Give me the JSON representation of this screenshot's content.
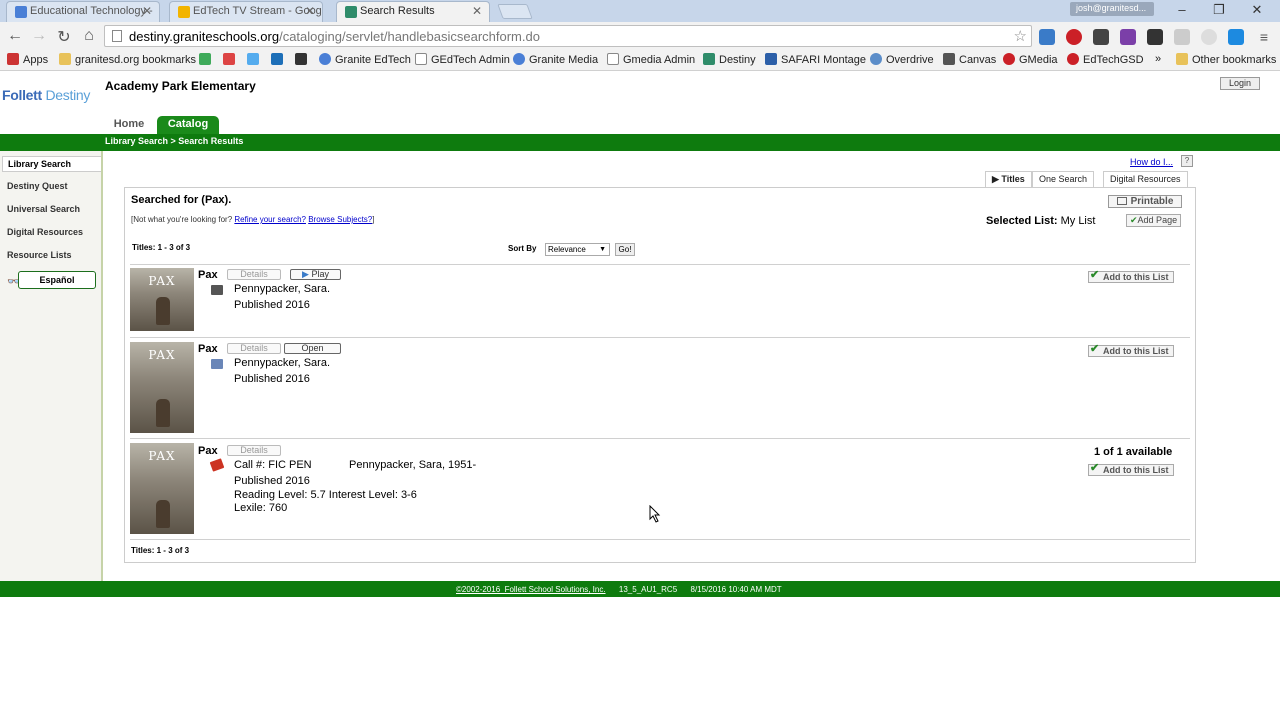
{
  "browser": {
    "tabs": [
      {
        "label": "Educational Technology -",
        "icon": "google-icon",
        "active": false
      },
      {
        "label": "EdTech TV Stream - Goog",
        "icon": "slides-icon",
        "active": false
      },
      {
        "label": "Search Results",
        "icon": "destiny-icon",
        "active": true
      }
    ],
    "profile": "josh@granitesd...",
    "url_host": "destiny.graniteschools.org",
    "url_path": "/cataloging/servlet/handlebasicsearchform.do",
    "bookmarks": [
      {
        "label": "Apps",
        "icon": "apps-grid-icon"
      },
      {
        "label": "granitesd.org bookmarks",
        "icon": "folder-icon"
      },
      {
        "label": "",
        "icon": "drive-icon"
      },
      {
        "label": "",
        "icon": "gmail-icon"
      },
      {
        "label": "",
        "icon": "twitter-icon"
      },
      {
        "label": "",
        "icon": "twitter-square-icon"
      },
      {
        "label": "",
        "icon": "layers-icon"
      },
      {
        "label": "Granite EdTech",
        "icon": "google-icon"
      },
      {
        "label": "GEdTech Admin",
        "icon": "page-icon"
      },
      {
        "label": "Granite Media",
        "icon": "google-icon"
      },
      {
        "label": "Gmedia Admin",
        "icon": "page-icon"
      },
      {
        "label": "Destiny",
        "icon": "destiny-icon"
      },
      {
        "label": "SAFARI Montage",
        "icon": "m-icon"
      },
      {
        "label": "Overdrive",
        "icon": "overdrive-icon"
      },
      {
        "label": "Canvas",
        "icon": "canvas-icon"
      },
      {
        "label": "GMedia",
        "icon": "pinterest-icon"
      },
      {
        "label": "EdTechGSD",
        "icon": "pinterest-icon"
      },
      {
        "label": "»",
        "icon": ""
      },
      {
        "label": "Other bookmarks",
        "icon": "folder-icon"
      }
    ]
  },
  "destiny": {
    "logo_main": "Follett",
    "logo_sub": "Destiny",
    "school": "Academy Park Elementary",
    "login": "Login",
    "nav": {
      "home": "Home",
      "catalog": "Catalog"
    },
    "breadcrumb": "Library Search > Search Results",
    "sidebar": [
      "Library Search",
      "Destiny Quest",
      "Universal Search",
      "Digital Resources",
      "Resource Lists"
    ],
    "espanol": "Español",
    "how_do_i": "How do I...",
    "help": "?",
    "subtabs": [
      "Titles",
      "One Search",
      "Digital Resources"
    ],
    "searched_for": "Searched for (Pax).",
    "refine_prefix": "[Not what you're looking for?",
    "refine_link": "Refine your search?",
    "browse_link": "Browse Subjects?",
    "refine_suffix": "]",
    "printable": "Printable",
    "selected_list_label": "Selected List:",
    "selected_list_value": "My List",
    "add_page": "Add Page",
    "titles_count": "Titles: 1 - 3 of 3",
    "sort_by": "Sort By",
    "sort_value": "Relevance",
    "go": "Go!",
    "results": [
      {
        "title": "Pax",
        "details": "Details",
        "action": "Play",
        "author": "Pennypacker, Sara.",
        "published": "Published 2016",
        "add_list": "Add to this List",
        "cover_text": "PAX"
      },
      {
        "title": "Pax",
        "details": "Details",
        "action": "Open",
        "author": "Pennypacker, Sara.",
        "published": "Published 2016",
        "add_list": "Add to this List",
        "cover_text": "PAX"
      },
      {
        "title": "Pax",
        "details": "Details",
        "call": "Call #: FIC PEN",
        "author": "Pennypacker, Sara, 1951-",
        "published": "Published 2016",
        "levels": "Reading Level: 5.7  Interest Level: 3-6",
        "lexile": "Lexile: 760",
        "availability": "1 of 1 available",
        "add_list": "Add to this List",
        "cover_text": "PAX"
      }
    ],
    "footer": {
      "copyright": "©2002-2016  Follett School Solutions, Inc.",
      "version": "13_5_AU1_RC5",
      "timestamp": "8/15/2016 10:40 AM MDT"
    }
  }
}
